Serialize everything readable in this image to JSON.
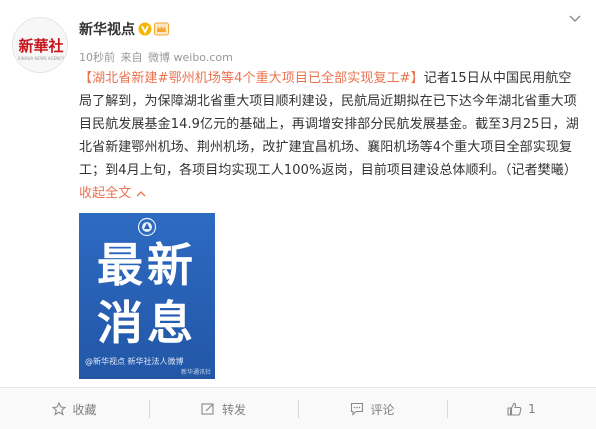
{
  "author": {
    "name": "新华视点",
    "avatar_text": "新華社",
    "avatar_subtext": "XINHUA NEWS AGENCY"
  },
  "meta": {
    "time": "10秒前",
    "source_prefix": "来自",
    "source": "微博 weibo.com"
  },
  "post": {
    "tag": "【湖北省新建#鄂州机场等4个重大项目已全部实现复工#】",
    "body": "记者15日从中国民用航空局了解到，为保障湖北省重大项目顺利建设，民航局近期拟在已下达今年湖北省重大项目民航发展基金14.9亿元的基础上，再调增安排部分民航发展基金。截至3月25日，湖北省新建鄂州机场、荆州机场，改扩建宜昌机场、襄阳机场等4个重大项目全部实现复工；到4月上旬，各项目均实现工人100%返岗，目前项目建设总体顺利。（记者樊曦）",
    "collapse_label": "收起全文"
  },
  "image": {
    "line1": "最新",
    "line2": "消息",
    "watermark": "@新华视点  新华社法人微博",
    "corner": "新华通讯社"
  },
  "actions": {
    "favorite": "收藏",
    "repost": "转发",
    "comment": "评论",
    "like": "1"
  },
  "colors": {
    "accent": "#eb7350",
    "image_bg": "#2860b5",
    "verified": "#f8b500"
  }
}
